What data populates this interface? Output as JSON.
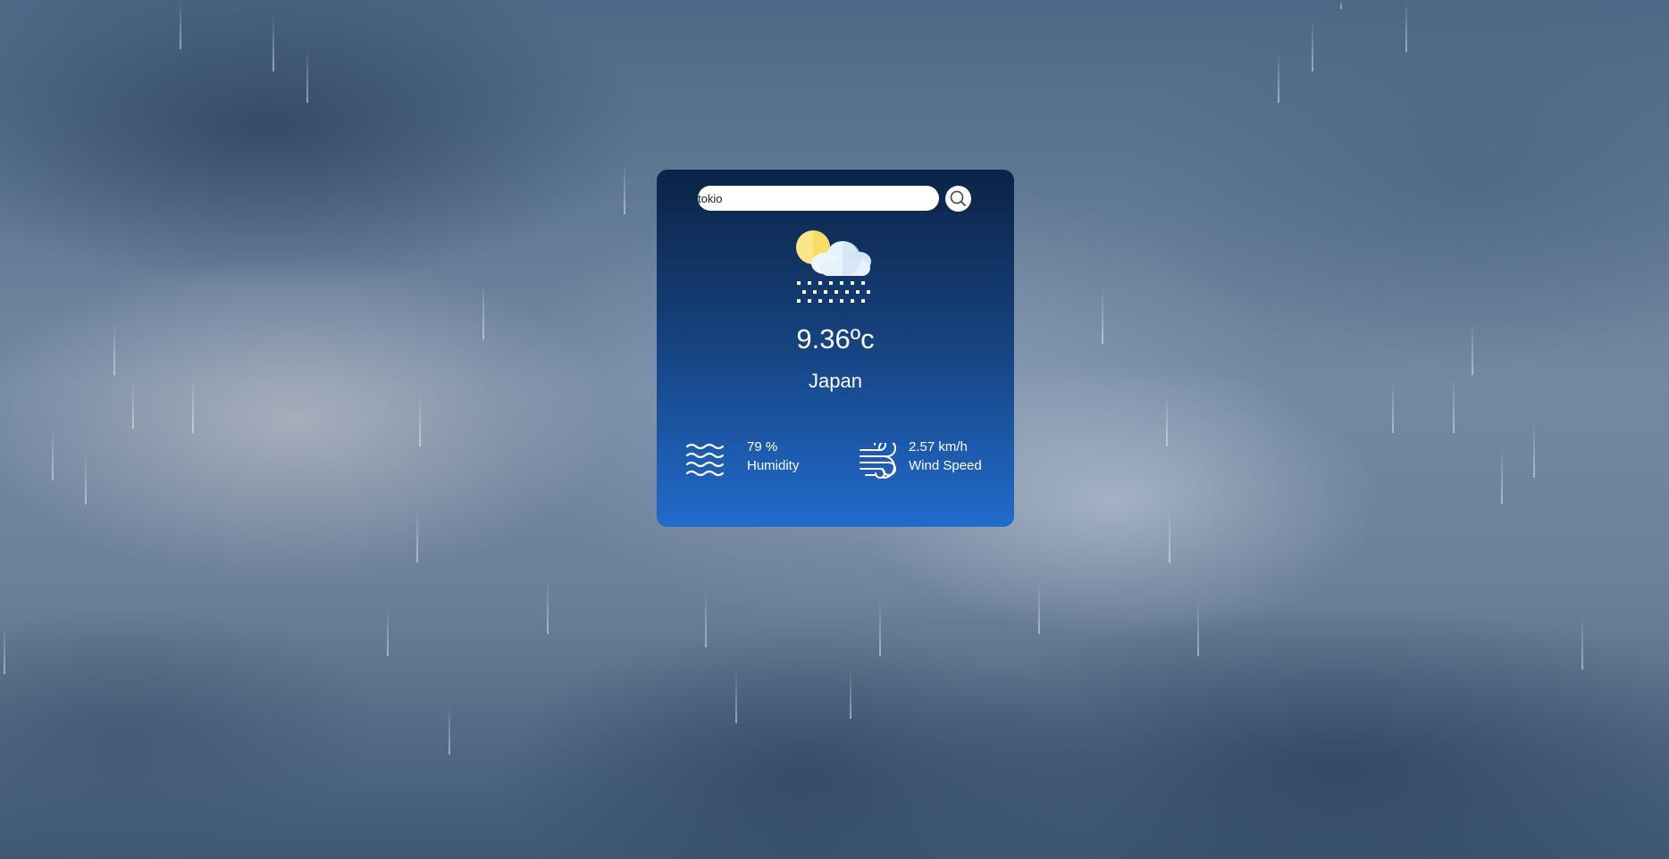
{
  "search": {
    "value": "tokio",
    "button_icon": "search-icon"
  },
  "weather": {
    "icon": "partly-cloudy-snow-icon",
    "temperature": "9.36ºc",
    "city": "Japan"
  },
  "details": {
    "humidity": {
      "icon": "waves-icon",
      "value": "79 %",
      "label": "Humidity"
    },
    "wind": {
      "icon": "wind-icon",
      "value": "2.57 km/h",
      "label": "Wind Speed"
    }
  },
  "colors": {
    "card_top": "#0b2346",
    "card_bottom": "#216bcc",
    "sun": "#fde68a",
    "cloud": "#dbeafe"
  }
}
